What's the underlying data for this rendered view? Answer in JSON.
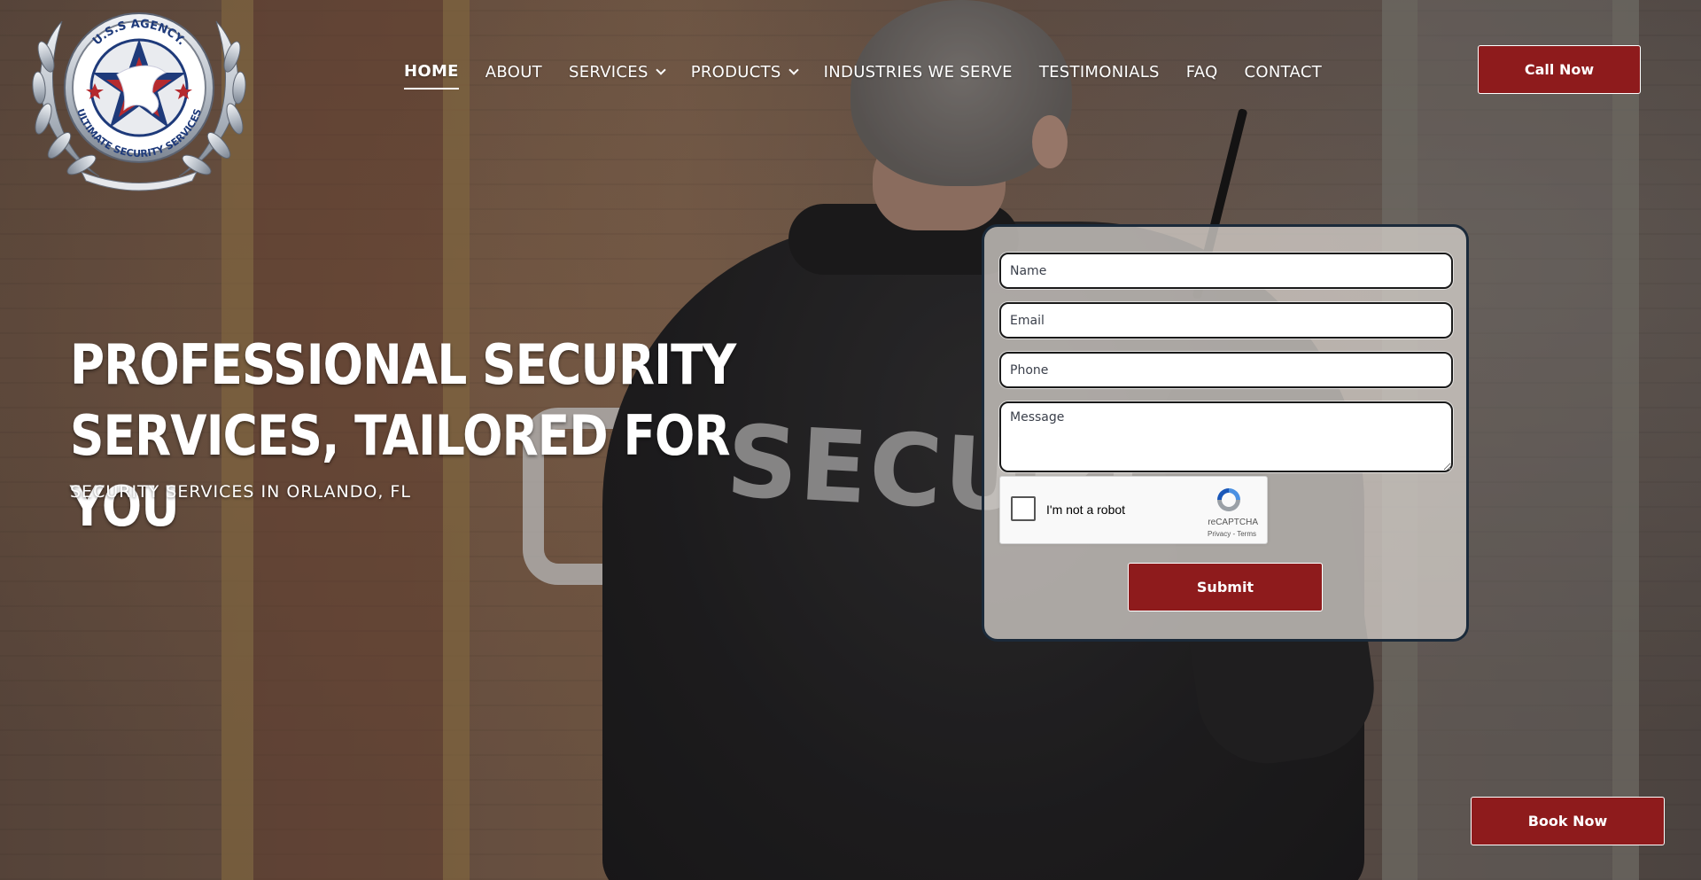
{
  "logo": {
    "top_text": "U.S.S AGENCY.",
    "bottom_text": "ULTIMATE SECURITY SERVICES"
  },
  "nav": {
    "items": [
      {
        "label": "HOME",
        "active": true,
        "has_dropdown": false
      },
      {
        "label": "ABOUT",
        "active": false,
        "has_dropdown": false
      },
      {
        "label": "SERVICES",
        "active": false,
        "has_dropdown": true
      },
      {
        "label": "PRODUCTS",
        "active": false,
        "has_dropdown": true
      },
      {
        "label": "INDUSTRIES WE SERVE",
        "active": false,
        "has_dropdown": false
      },
      {
        "label": "TESTIMONIALS",
        "active": false,
        "has_dropdown": false
      },
      {
        "label": "FAQ",
        "active": false,
        "has_dropdown": false
      },
      {
        "label": "CONTACT",
        "active": false,
        "has_dropdown": false
      }
    ],
    "dropdown_icon": "chevron-down-icon"
  },
  "header": {
    "call_label": "Call Now"
  },
  "hero": {
    "title": "PROFESSIONAL SECURITY SERVICES, TAILORED FOR YOU",
    "subtitle": "SECURITY SERVICES IN ORLANDO, FL",
    "jacket_text": "SECURI"
  },
  "form": {
    "name_placeholder": "Name",
    "email_placeholder": "Email",
    "phone_placeholder": "Phone",
    "message_placeholder": "Message",
    "captcha": {
      "label": "I'm not a robot",
      "brand": "reCAPTCHA",
      "links": "Privacy - Terms",
      "checked": false
    },
    "submit_label": "Submit"
  },
  "book_label": "Book Now",
  "colors": {
    "accent_red": "#8e1b1c",
    "panel_border": "#1b2a3a",
    "text_white": "#ffffff"
  }
}
